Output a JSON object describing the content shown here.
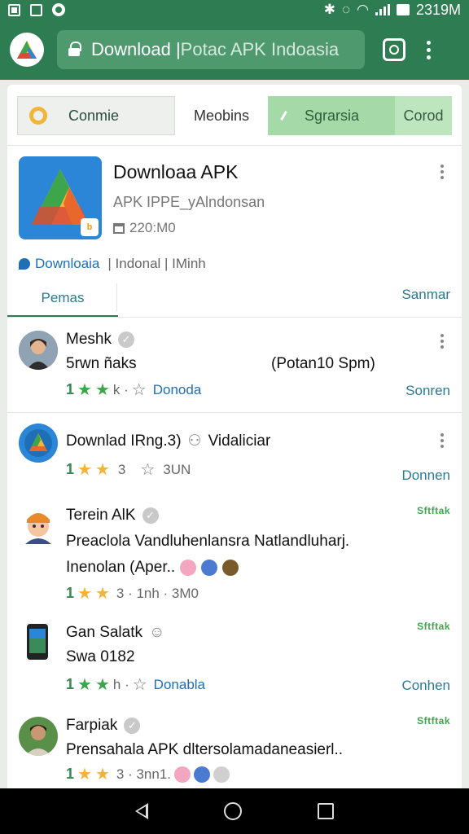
{
  "status_bar": {
    "time": "2319M",
    "icons": [
      "image-icon",
      "gallery-icon",
      "notification-icon",
      "bluetooth-icon",
      "alarm-icon",
      "wifi-icon",
      "signal-icon",
      "battery-icon"
    ]
  },
  "browser": {
    "url_host": "Download |",
    "url_rest": " Potac APK Indoasia",
    "colors": {
      "toolbar": "#2e7d52",
      "urlbox": "#4e9a6e"
    }
  },
  "filters": {
    "chip1": "Conmie",
    "chip2": "Meobins",
    "chip3": "Sgrarsia",
    "chip4": "Corod"
  },
  "app": {
    "title": "Downloaa APK",
    "subtitle": "APK IPPE_yAlndonsan",
    "size": "220:M0",
    "badge": "b",
    "download_link": "Downloaia",
    "meta": "| Indonal | IMinh"
  },
  "tabs": {
    "left": "Pemas",
    "right": "Sanmar"
  },
  "reviews": [
    {
      "name": "Meshk",
      "line1_left": "5rwn ñaks",
      "line1_right": "(Potan10 Spm)",
      "rating_num": "1",
      "meta": "k ·",
      "link": "Donoda",
      "right": "Sonren"
    },
    {
      "name": "Downlad IRng.3)",
      "name_extra": "Vidaliciar",
      "rating_num": "1",
      "meta": "3",
      "meta2": "3UN",
      "right": "Donnen"
    },
    {
      "name": "Terein AlK",
      "tag": "Sftftak",
      "line1": "Preaclola Vandluhenlansra Natlandluharj.",
      "line2": "Inenolan (Aper..",
      "rating_num": "1",
      "meta": "3 · 1nh · 3M0"
    },
    {
      "name": "Gan Salatk",
      "tag": "Sftftak",
      "line1": "Swa 0182",
      "rating_num": "1",
      "meta": "h ·",
      "link": "Donabla",
      "right": "Conhen"
    },
    {
      "name": "Farpiak",
      "tag": "Sftftak",
      "line1": "Prensahala APK dltersolamadaneasierl..",
      "rating_num": "1",
      "meta": "3 · 3nn1."
    }
  ]
}
